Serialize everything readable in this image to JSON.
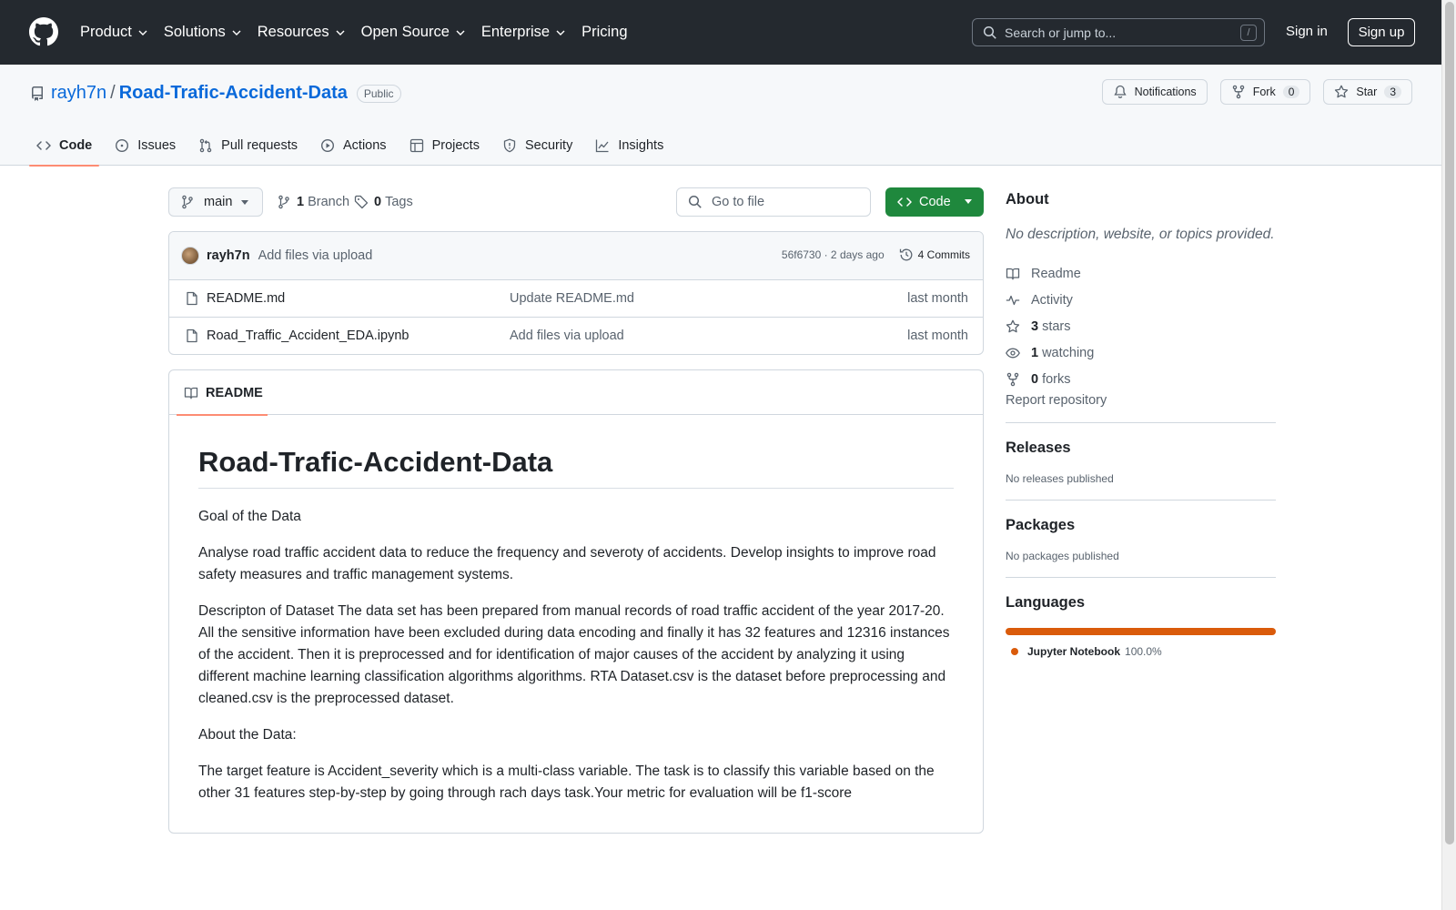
{
  "header": {
    "nav": [
      {
        "label": "Product",
        "dropdown": true
      },
      {
        "label": "Solutions",
        "dropdown": true
      },
      {
        "label": "Resources",
        "dropdown": true
      },
      {
        "label": "Open Source",
        "dropdown": true
      },
      {
        "label": "Enterprise",
        "dropdown": true
      },
      {
        "label": "Pricing",
        "dropdown": false
      }
    ],
    "search_placeholder": "Search or jump to...",
    "search_key": "/",
    "signin": "Sign in",
    "signup": "Sign up"
  },
  "repo": {
    "owner": "rayh7n",
    "separator": "/",
    "name": "Road-Trafic-Accident-Data",
    "visibility": "Public",
    "actions": {
      "notifications": "Notifications",
      "fork": "Fork",
      "fork_count": "0",
      "star": "Star",
      "star_count": "3"
    },
    "tabs": [
      {
        "label": "Code",
        "icon": "code-icon",
        "active": true
      },
      {
        "label": "Issues",
        "icon": "issue-icon",
        "active": false
      },
      {
        "label": "Pull requests",
        "icon": "pull-request-icon",
        "active": false
      },
      {
        "label": "Actions",
        "icon": "play-icon",
        "active": false
      },
      {
        "label": "Projects",
        "icon": "table-icon",
        "active": false
      },
      {
        "label": "Security",
        "icon": "shield-icon",
        "active": false
      },
      {
        "label": "Insights",
        "icon": "graph-icon",
        "active": false
      }
    ]
  },
  "toolbar": {
    "branch": "main",
    "branch_count": "1",
    "branch_label": "Branch",
    "tag_count": "0",
    "tag_label": "Tags",
    "goto_placeholder": "Go to file",
    "code_button": "Code"
  },
  "commit": {
    "author": "rayh7n",
    "message": "Add files via upload",
    "hash_time": "56f6730 · 2 days ago",
    "commits_label": "4 Commits"
  },
  "files": [
    {
      "name": "README.md",
      "message": "Update README.md",
      "date": "last month"
    },
    {
      "name": "Road_Traffic_Accident_EDA.ipynb",
      "message": "Add files via upload",
      "date": "last month"
    }
  ],
  "readme": {
    "tab": "README",
    "title": "Road-Trafic-Accident-Data",
    "paragraphs": [
      "Goal of the Data",
      "Analyse road traffic accident data to reduce the frequency and severoty of accidents. Develop insights to improve road safety measures and traffic management systems.",
      "Descripton of Dataset The data set has been prepared from manual records of road traffic accident of the year 2017-20. All the sensitive information have been excluded during data encoding and finally it has 32 features and 12316 instances of the accident. Then it is preprocessed and for identification of major causes of the accident by analyzing it using different machine learning classification algorithms algorithms. RTA Dataset.csv is the dataset before preprocessing and cleaned.csv is the preprocessed dataset.",
      "About the Data:",
      "The target feature is Accident_severity which is a multi-class variable. The task is to classify this variable based on the other 31 features step-by-step by going through rach days task.Your metric for evaluation will be f1-score"
    ]
  },
  "sidebar": {
    "about_title": "About",
    "about_desc": "No description, website, or topics provided.",
    "readme_link": "Readme",
    "activity_link": "Activity",
    "stars_count": "3",
    "stars_label": "stars",
    "watching_count": "1",
    "watching_label": "watching",
    "forks_count": "0",
    "forks_label": "forks",
    "report": "Report repository",
    "releases_title": "Releases",
    "releases_empty": "No releases published",
    "packages_title": "Packages",
    "packages_empty": "No packages published",
    "languages_title": "Languages",
    "language_name": "Jupyter Notebook",
    "language_pct": "100.0%",
    "language_color": "#da5b0b"
  }
}
